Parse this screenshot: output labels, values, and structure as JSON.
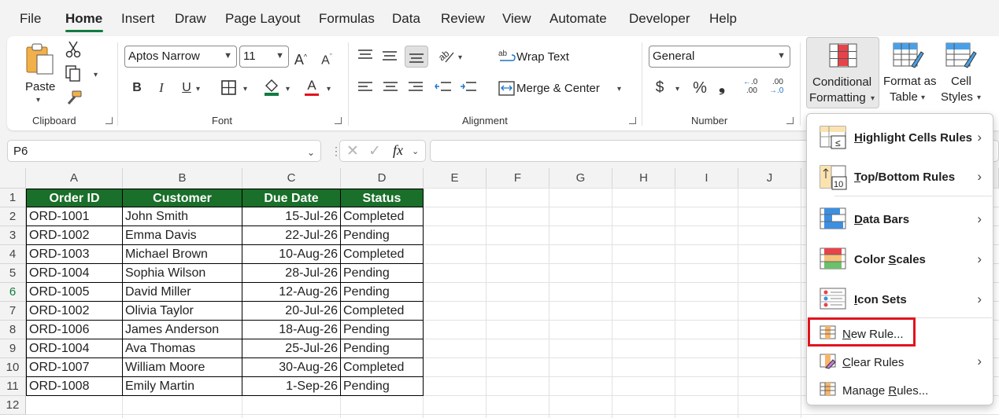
{
  "tabs": [
    "File",
    "Home",
    "Insert",
    "Draw",
    "Page Layout",
    "Formulas",
    "Data",
    "Review",
    "View",
    "Automate",
    "Developer",
    "Help"
  ],
  "active_tab": "Home",
  "ribbon": {
    "clipboard": {
      "paste": "Paste",
      "group": "Clipboard"
    },
    "font": {
      "name": "Aptos Narrow",
      "size": "11",
      "group": "Font",
      "bold": "B",
      "italic": "I",
      "grow": "A",
      "shrink": "A",
      "color": "A"
    },
    "alignment": {
      "wrap": "Wrap Text",
      "merge": "Merge & Center",
      "group": "Alignment"
    },
    "number": {
      "format": "General",
      "currency": "$",
      "percent": "%",
      "comma": "9",
      "group": "Number",
      "inc_dec": ".0",
      "inc_dec2": ".00",
      "dec_dec": ".00",
      "dec_dec2": "→.0"
    },
    "styles": {
      "cf_line1": "Conditional",
      "cf_line2": "Formatting",
      "fat_line1": "Format as",
      "fat_line2": "Table",
      "cs_line1": "Cell",
      "cs_line2": "Styles"
    }
  },
  "formula_bar": {
    "name_box": "P6",
    "fx": "fx",
    "value": ""
  },
  "columns": [
    "A",
    "B",
    "C",
    "D",
    "E",
    "F",
    "G",
    "H",
    "I",
    "J"
  ],
  "rows": [
    "1",
    "2",
    "3",
    "4",
    "5",
    "6",
    "7",
    "8",
    "9",
    "10",
    "11",
    "12"
  ],
  "selected_row": "6",
  "table": {
    "headers": [
      "Order ID",
      "Customer",
      "Due Date",
      "Status"
    ],
    "rows": [
      [
        "ORD-1001",
        "John Smith",
        "15-Jul-26",
        "Completed"
      ],
      [
        "ORD-1002",
        "Emma Davis",
        "22-Jul-26",
        "Pending"
      ],
      [
        "ORD-1003",
        "Michael Brown",
        "10-Aug-26",
        "Completed"
      ],
      [
        "ORD-1004",
        "Sophia Wilson",
        "28-Jul-26",
        "Pending"
      ],
      [
        "ORD-1005",
        "David Miller",
        "12-Aug-26",
        "Pending"
      ],
      [
        "ORD-1002",
        "Olivia Taylor",
        "20-Jul-26",
        "Completed"
      ],
      [
        "ORD-1006",
        "James Anderson",
        "18-Aug-26",
        "Pending"
      ],
      [
        "ORD-1004",
        "Ava Thomas",
        "25-Jul-26",
        "Pending"
      ],
      [
        "ORD-1007",
        "William Moore",
        "30-Aug-26",
        "Completed"
      ],
      [
        "ORD-1008",
        "Emily Martin",
        "1-Sep-26",
        "Pending"
      ]
    ]
  },
  "menu": {
    "items": [
      {
        "label": "Highlight Cells Rules",
        "accel": "H",
        "icon": "highlight-cells-icon",
        "submenu": true
      },
      {
        "label": "Top/Bottom Rules",
        "accel": "T",
        "icon": "top-bottom-icon",
        "submenu": true
      },
      {
        "label": "Data Bars",
        "accel": "D",
        "icon": "data-bars-icon",
        "submenu": true
      },
      {
        "label": "Color Scales",
        "accel": "S",
        "icon": "color-scales-icon",
        "submenu": true
      },
      {
        "label": "Icon Sets",
        "accel": "I",
        "icon": "icon-sets-icon",
        "submenu": true
      },
      {
        "label": "New Rule...",
        "accel": "N",
        "icon": "new-rule-icon",
        "submenu": false,
        "highlighted": true
      },
      {
        "label": "Clear Rules",
        "accel": "C",
        "icon": "clear-rules-icon",
        "submenu": true
      },
      {
        "label": "Manage Rules...",
        "accel": "R",
        "icon": "manage-rules-icon",
        "submenu": false
      }
    ],
    "icon_labels": {
      "highlight": "≤",
      "topbottom": "10"
    }
  },
  "colors": {
    "accent": "#107c41",
    "header_fill": "#1a6f2a",
    "highlight_box": "#e0141e"
  }
}
